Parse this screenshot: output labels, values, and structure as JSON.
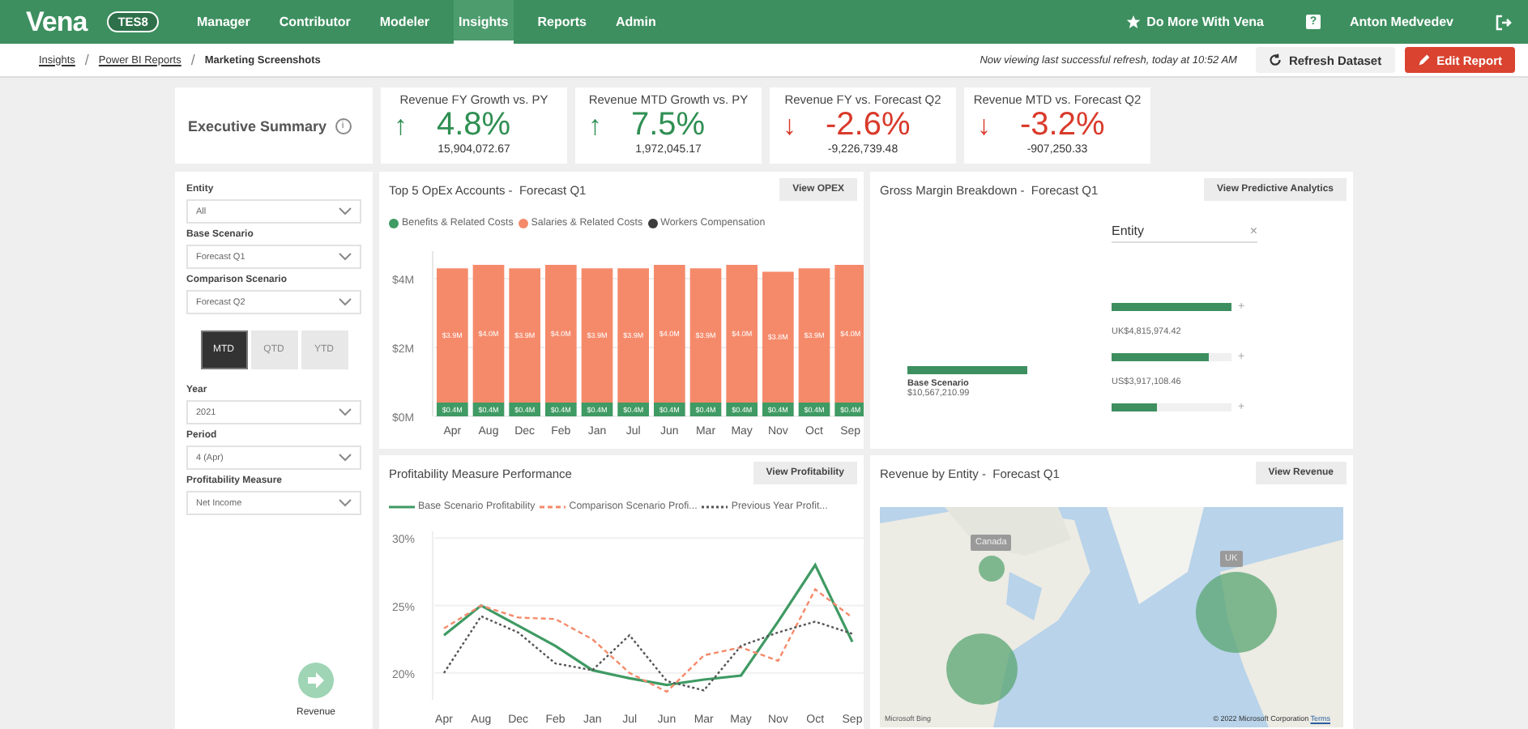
{
  "nav": {
    "logo": "Vena",
    "env_badge": "TES8",
    "items": [
      {
        "label": "Manager",
        "selected": false
      },
      {
        "label": "Contributor",
        "selected": false
      },
      {
        "label": "Modeler",
        "selected": false
      },
      {
        "label": "Insights",
        "selected": true
      },
      {
        "label": "Reports",
        "selected": false
      },
      {
        "label": "Admin",
        "selected": false
      }
    ],
    "promo": "Do More With Vena",
    "help": "?",
    "user": "Anton Medvedev"
  },
  "breadcrumb": {
    "links": [
      "Insights",
      "Power BI Reports"
    ],
    "separator": "/",
    "current": "Marketing Screenshots",
    "refresh_note": "Now viewing last successful refresh, today at 10:52 AM",
    "refresh_button": "Refresh Dataset",
    "edit_button": "Edit Report"
  },
  "summary": {
    "title": "Executive Summary",
    "info": "i"
  },
  "kpis": [
    {
      "title": "Revenue FY Growth vs. PY",
      "kind": "up",
      "arrow": "↑",
      "value": "4.8%",
      "amount": "15,904,072.67"
    },
    {
      "title": "Revenue MTD Growth vs. PY",
      "kind": "up",
      "arrow": "↑",
      "value": "7.5%",
      "amount": "1,972,045.17"
    },
    {
      "title": "Revenue FY vs. Forecast Q2",
      "kind": "down",
      "arrow": "↓",
      "value": "-2.6%",
      "amount": "-9,226,739.48"
    },
    {
      "title": "Revenue MTD vs. Forecast Q2",
      "kind": "down",
      "arrow": "↓",
      "value": "-3.2%",
      "amount": "-907,250.33"
    }
  ],
  "filters": {
    "top": [
      {
        "label": "Entity",
        "value": "All"
      },
      {
        "label": "Base Scenario",
        "value": "Forecast Q1"
      },
      {
        "label": "Comparison Scenario",
        "value": "Forecast Q2"
      }
    ],
    "periods": [
      {
        "label": "MTD",
        "selected": true
      },
      {
        "label": "QTD",
        "selected": false
      },
      {
        "label": "YTD",
        "selected": false
      }
    ],
    "bottom": [
      {
        "label": "Year",
        "value": "2021"
      },
      {
        "label": "Period",
        "value": "4 (Apr)"
      },
      {
        "label": "Profitability Measure",
        "value": "Net Income"
      }
    ],
    "nav_button": "Revenue"
  },
  "opex": {
    "title": "Top 5 OpEx Accounts -  Forecast Q1",
    "button": "View OPEX",
    "chart_data": {
      "type": "bar",
      "stacked": true,
      "categories": [
        "Apr",
        "Aug",
        "Dec",
        "Feb",
        "Jan",
        "Jul",
        "Jun",
        "Mar",
        "May",
        "Nov",
        "Oct",
        "Sep"
      ],
      "series": [
        {
          "name": "Benefits & Related Costs",
          "color": "#3f9a63",
          "values": [
            0.4,
            0.4,
            0.4,
            0.4,
            0.4,
            0.4,
            0.4,
            0.4,
            0.4,
            0.4,
            0.4,
            0.4
          ]
        },
        {
          "name": "Salaries & Related Costs",
          "color": "#f58a6b",
          "values": [
            3.9,
            4.0,
            3.9,
            4.0,
            3.9,
            3.9,
            4.0,
            3.9,
            4.0,
            3.8,
            3.9,
            4.0
          ]
        },
        {
          "name": "Workers Compensation",
          "color": "#3c3c3c",
          "values": [
            0,
            0,
            0,
            0,
            0,
            0,
            0,
            0,
            0,
            0,
            0,
            0
          ]
        }
      ],
      "ylim": [
        0,
        4.8
      ],
      "yticks": [
        {
          "value": 0,
          "label": "$0M"
        },
        {
          "value": 2,
          "label": "$2M"
        },
        {
          "value": 4,
          "label": "$4M"
        }
      ],
      "value_labels": [
        [
          "$0.4M",
          "$0.4M",
          "$0.4M",
          "$0.4M",
          "$0.4M",
          "$0.4M",
          "$0.4M",
          "$0.4M",
          "$0.4M",
          "$0.4M",
          "$0.4M",
          "$0.4M"
        ],
        [
          "$3.9M",
          "$4.0M",
          "$3.9M",
          "$4.0M",
          "$3.9M",
          "$3.9M",
          "$4.0M",
          "$3.9M",
          "$4.0M",
          "$3.8M",
          "$3.9M",
          "$4.0M"
        ]
      ]
    }
  },
  "margin": {
    "title": "Gross Margin Breakdown -  Forecast Q1",
    "button": "View Predictive Analytics",
    "level_header": "Entity",
    "clear": "×",
    "root": {
      "label": "Base Scenario",
      "amount": "$10,567,210.99",
      "level": 1
    },
    "children": [
      {
        "label": "UK",
        "amount": "$4,815,974.42",
        "level": 1,
        "expand": "+"
      },
      {
        "label": "US",
        "amount": "$3,917,108.46",
        "level": 0.81,
        "expand": "+"
      },
      {
        "level": 0.38,
        "expand": "+"
      }
    ]
  },
  "profit": {
    "title": "Profitability Measure Performance",
    "button": "View Profitability",
    "chart_data": {
      "type": "line",
      "categories": [
        "Apr",
        "Aug",
        "Dec",
        "Feb",
        "Jan",
        "Jul",
        "Jun",
        "Mar",
        "May",
        "Nov",
        "Oct",
        "Sep"
      ],
      "series": [
        {
          "name": "Base Scenario Profitability",
          "color": "#3f9a63",
          "line_style": "solid",
          "values": [
            22.8,
            25.0,
            23.5,
            22.0,
            20.2,
            19.6,
            19.1,
            19.5,
            19.8,
            23.8,
            28.0,
            22.3
          ]
        },
        {
          "name": "Comparison Scenario Profi...",
          "color": "#f58a6b",
          "line_style": "dashed",
          "values": [
            23.3,
            25.0,
            24.1,
            24.0,
            22.5,
            20.0,
            18.6,
            21.3,
            21.9,
            20.9,
            26.2,
            24.1
          ]
        },
        {
          "name": "Previous Year Profit...",
          "color": "#555555",
          "line_style": "dotted",
          "values": [
            20.0,
            24.2,
            23.0,
            20.7,
            20.2,
            22.8,
            19.4,
            18.7,
            22.0,
            23.0,
            23.8,
            22.9
          ]
        }
      ],
      "grid": true,
      "ylim": [
        18,
        30.5
      ],
      "yticks": [
        {
          "value": 20,
          "label": "20%"
        },
        {
          "value": 25,
          "label": "25%"
        },
        {
          "value": 30,
          "label": "30%"
        }
      ]
    }
  },
  "revenue": {
    "title": "Revenue by Entity -  Forecast Q1",
    "button": "View Revenue",
    "map": {
      "kind": "picture",
      "bubble_labels": [
        "Canada",
        "UK"
      ],
      "brand": "Microsoft Bing",
      "copyright": "© 2022 Microsoft Corporation",
      "terms": "Terms"
    }
  }
}
